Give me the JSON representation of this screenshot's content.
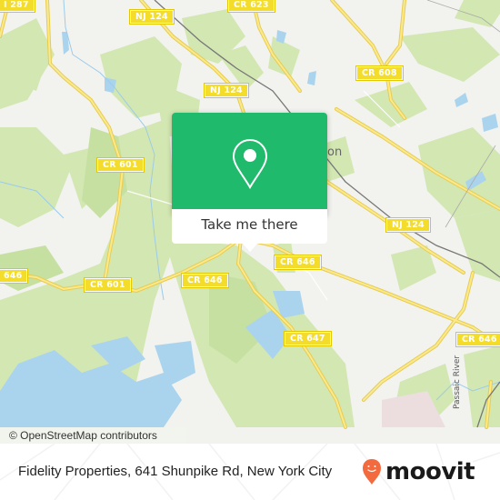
{
  "map": {
    "road_labels": [
      {
        "id": "i287",
        "text": "I 287"
      },
      {
        "id": "nj124-a",
        "text": "NJ 124"
      },
      {
        "id": "cr623",
        "text": "CR 623"
      },
      {
        "id": "nj124-b",
        "text": "NJ 124"
      },
      {
        "id": "cr608",
        "text": "CR 608"
      },
      {
        "id": "cr601-a",
        "text": "CR 601"
      },
      {
        "id": "nj124-c",
        "text": "NJ 124"
      },
      {
        "id": "cr646-a",
        "text": "646"
      },
      {
        "id": "cr601-b",
        "text": "CR 601"
      },
      {
        "id": "cr646-b",
        "text": "CR 646"
      },
      {
        "id": "cr646-c",
        "text": "CR 646"
      },
      {
        "id": "cr647",
        "text": "CR 647"
      },
      {
        "id": "cr646-d",
        "text": "CR 646"
      }
    ],
    "place_label": "on",
    "river_label": "Passaic River",
    "attribution": "© OpenStreetMap contributors",
    "colors": {
      "land": "#f2f2ef",
      "park": "#cfe5ae",
      "water": "#aad4ee",
      "road": "#f6e27a",
      "shield": "#f4dd2a"
    }
  },
  "popup": {
    "button_label": "Take me there",
    "color": "#1fba6b"
  },
  "footer": {
    "address": "Fidelity Properties, 641 Shunpike Rd, New York City",
    "brand": "moovit",
    "brand_color": "#f26a3d"
  }
}
